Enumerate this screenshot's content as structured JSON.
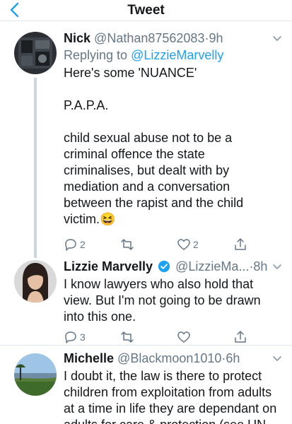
{
  "nav": {
    "title": "Tweet"
  },
  "tweets": [
    {
      "name": "Nick",
      "handle": "@Nathan87562083",
      "dot": "·",
      "time": "9h",
      "replying_label": "Replying to",
      "replying_mention": "@LizzieMarvelly",
      "lines": [
        "Here's some 'NUANCE'",
        "",
        "P.A.P.A.",
        "",
        "child sexual abuse not to be a",
        "criminal offence the state",
        "criminalises, but dealt with by",
        "mediation and a conversation",
        "between the rapist and the child",
        "victim.😆"
      ],
      "reply_count": "2",
      "like_count": "2"
    },
    {
      "name": "Lizzie Marvelly",
      "handle": "@LizzieMa...",
      "dot": "·",
      "time": "8h",
      "lines": [
        "I know lawyers who also hold that",
        "view. But I'm not going to be drawn",
        "into this one."
      ],
      "reply_count": "3"
    },
    {
      "name": "Michelle",
      "handle": "@Blackmoon1010",
      "dot": "·",
      "time": "6h",
      "lines": [
        "I doubt it, the law is there to protect",
        "children from exploitation from adults",
        "at a time in life they are dependant on",
        "adults for care & protection (see UN"
      ]
    }
  ],
  "icons": {
    "back": "chevron-left-icon",
    "reply": "reply-icon",
    "retweet": "retweet-icon",
    "like": "heart-icon",
    "share": "share-icon",
    "caret": "chevron-down-icon",
    "verified": "verified-badge-icon"
  },
  "colors": {
    "accent": "#1da1f2",
    "muted": "#657786",
    "text": "#14171a"
  }
}
